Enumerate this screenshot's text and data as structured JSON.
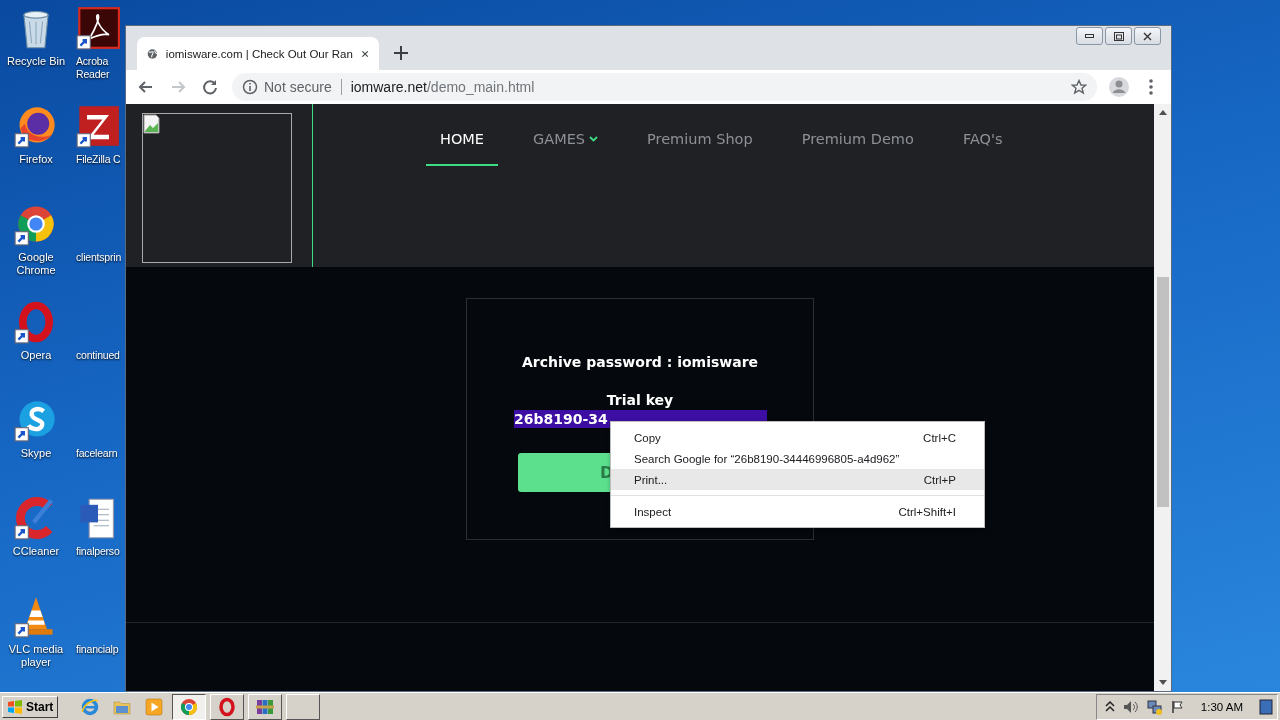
{
  "desktop": {
    "icons": [
      {
        "label": "Recycle Bin",
        "kind": "trash-bin",
        "shortcut": false
      },
      {
        "label": "Acroba Reader",
        "kind": "pdf",
        "shortcut": true
      },
      {
        "label": "Firefox",
        "kind": "fox",
        "shortcut": true
      },
      {
        "label": "FileZilla C",
        "kind": "ftp",
        "shortcut": true
      },
      {
        "label": "Google Chrome",
        "kind": "tricolor-ring",
        "shortcut": true
      },
      {
        "label": "clientsprin",
        "kind": "blank"
      },
      {
        "label": "Opera",
        "kind": "red-ring",
        "shortcut": true
      },
      {
        "label": "continued",
        "kind": "blank"
      },
      {
        "label": "Skype",
        "kind": "chat-bubble",
        "shortcut": true
      },
      {
        "label": "facelearn",
        "kind": "blank"
      },
      {
        "label": "CCleaner",
        "kind": "brush",
        "shortcut": true
      },
      {
        "label": "finalperso",
        "kind": "word-document",
        "shortcut": false
      },
      {
        "label": "VLC media player",
        "kind": "traffic-cone",
        "shortcut": true
      },
      {
        "label": "financialp",
        "kind": "blank"
      }
    ]
  },
  "browser": {
    "tab": {
      "title": "iomisware.com | Check Out Our Ran"
    },
    "address": {
      "security": "Not secure",
      "host": "iomware.net",
      "path": "/demo_main.html"
    }
  },
  "page": {
    "nav": [
      {
        "label": "HOME",
        "selected": true,
        "dropdown": false
      },
      {
        "label": "GAMES",
        "selected": false,
        "dropdown": true
      },
      {
        "label": "Premium Shop",
        "selected": false,
        "dropdown": false
      },
      {
        "label": "Premium Demo",
        "selected": false,
        "dropdown": false
      },
      {
        "label": "FAQ's",
        "selected": false,
        "dropdown": false
      }
    ],
    "card": {
      "password_line": "Archive password : iomisware",
      "key_label": "Trial key",
      "key_value": "26b8190-34",
      "key_highlighted": true,
      "button": "D"
    }
  },
  "context_menu": [
    {
      "kind": "item",
      "label": "Copy",
      "shortcut": "Ctrl+C",
      "selected": false
    },
    {
      "kind": "item",
      "label": "Search Google for “26b8190-34446996805-a4d962”",
      "selected": false
    },
    {
      "kind": "item",
      "label": "Print...",
      "shortcut": "Ctrl+P",
      "selected": true
    },
    {
      "kind": "separator"
    },
    {
      "kind": "item",
      "label": "Inspect",
      "shortcut": "Ctrl+Shift+I",
      "selected": false
    }
  ],
  "taskbar": {
    "start": "Start",
    "quick_launch": [
      {
        "kind": "ie"
      },
      {
        "kind": "folder"
      },
      {
        "kind": "media-player"
      }
    ],
    "tasks": [
      {
        "kind": "tricolor-ring",
        "selected": true
      },
      {
        "kind": "red-ring",
        "selected": false
      },
      {
        "kind": "archive",
        "selected": false
      },
      {
        "kind": "blank",
        "selected": false
      }
    ],
    "clock": "1:30 AM"
  }
}
